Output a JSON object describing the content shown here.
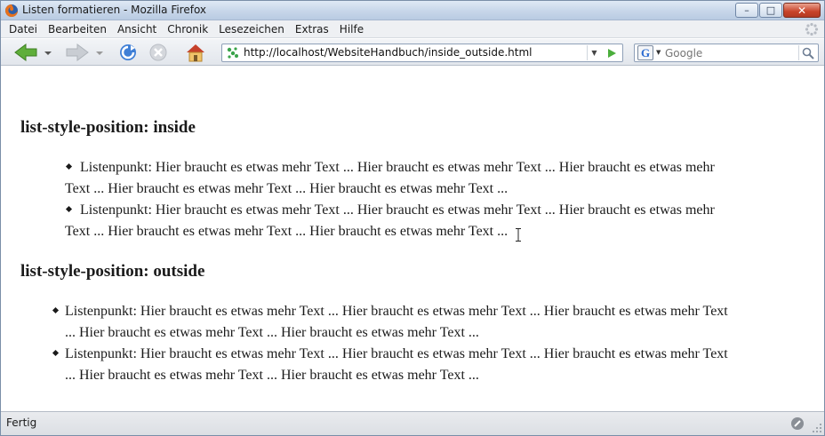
{
  "window": {
    "title": "Listen formatieren - Mozilla Firefox",
    "minimize_glyph": "–",
    "maximize_glyph": "□",
    "close_glyph": "✕"
  },
  "menubar": {
    "items": [
      {
        "label": "Datei"
      },
      {
        "label": "Bearbeiten"
      },
      {
        "label": "Ansicht"
      },
      {
        "label": "Chronik"
      },
      {
        "label": "Lesezeichen"
      },
      {
        "label": "Extras"
      },
      {
        "label": "Hilfe"
      }
    ]
  },
  "toolbar": {
    "url": "http://localhost/WebsiteHandbuch/inside_outside.html",
    "url_dropdown_glyph": "▼",
    "search_engine_letter": "G",
    "search_engine_drop_glyph": "▼",
    "search_placeholder": "Google",
    "icons": {
      "back": "back-arrow-icon",
      "forward": "forward-arrow-icon",
      "reload": "reload-icon",
      "stop": "stop-icon",
      "home": "home-icon",
      "go": "go-arrow-icon",
      "search": "magnifier-icon"
    }
  },
  "content": {
    "inside": {
      "heading": "list-style-position: inside",
      "items": [
        {
          "line1": "Listenpunkt: Hier braucht es etwas mehr Text ... Hier braucht es etwas mehr Text ... Hier braucht es etwas mehr",
          "line2": "Text ... Hier braucht es etwas mehr Text ... Hier braucht es etwas mehr Text ..."
        },
        {
          "line1": "Listenpunkt: Hier braucht es etwas mehr Text ... Hier braucht es etwas mehr Text ... Hier braucht es etwas mehr",
          "line2": "Text ... Hier braucht es etwas mehr Text ... Hier braucht es etwas mehr Text ..."
        }
      ]
    },
    "outside": {
      "heading": "list-style-position: outside",
      "items": [
        {
          "line1": "Listenpunkt: Hier braucht es etwas mehr Text ... Hier braucht es etwas mehr Text ... Hier braucht es etwas mehr Text",
          "line2": "... Hier braucht es etwas mehr Text ... Hier braucht es etwas mehr Text ..."
        },
        {
          "line1": "Listenpunkt: Hier braucht es etwas mehr Text ... Hier braucht es etwas mehr Text ... Hier braucht es etwas mehr Text",
          "line2": "... Hier braucht es etwas mehr Text ... Hier braucht es etwas mehr Text ..."
        }
      ]
    }
  },
  "statusbar": {
    "text": "Fertig"
  },
  "colors": {
    "titlebar": "#c7d6e9",
    "close_button": "#c8432a",
    "text": "#1a1a1a"
  }
}
